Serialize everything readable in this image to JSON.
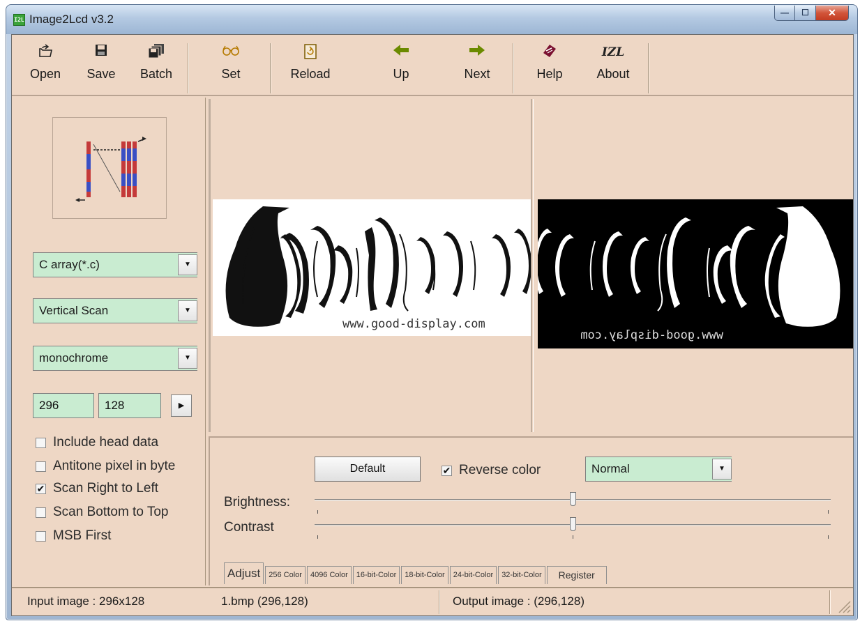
{
  "window": {
    "title": "Image2Lcd v3.2",
    "icon_text": "I2L",
    "controls": {
      "minimize": "—",
      "maximize": "☐",
      "close": "✕"
    }
  },
  "toolbar": {
    "open": "Open",
    "save": "Save",
    "batch": "Batch",
    "set": "Set",
    "reload": "Reload",
    "up": "Up",
    "next": "Next",
    "help": "Help",
    "about": "About",
    "about_icon_text": "IZL"
  },
  "left_panel": {
    "output_type": "C array(*.c)",
    "scan_mode": "Vertical Scan",
    "color_depth": "monochrome",
    "width": "296",
    "height": "128",
    "options": [
      {
        "label": "Include head data",
        "checked": false
      },
      {
        "label": "Antitone pixel in byte",
        "checked": false
      },
      {
        "label": "Scan Right to Left",
        "checked": true
      },
      {
        "label": "Scan Bottom to Top",
        "checked": false
      },
      {
        "label": "MSB First",
        "checked": false
      }
    ]
  },
  "preview": {
    "input_caption": "www.good-display.com",
    "output_caption": "www.good-display.com"
  },
  "adjust": {
    "default_button": "Default",
    "reverse_color_label": "Reverse color",
    "reverse_color_checked": true,
    "mode": "Normal",
    "brightness_label": "Brightness:",
    "contrast_label": "Contrast",
    "brightness_level": 0.5,
    "contrast_level": 0.5
  },
  "tabs": [
    "Adjust",
    "256 Color",
    "4096 Color",
    "16-bit-Color",
    "18-bit-Color",
    "24-bit-Color",
    "32-bit-Color",
    "Register"
  ],
  "status": {
    "input": "Input image : 296x128",
    "file": "1.bmp  (296,128)",
    "output": "Output image :  (296,128)"
  },
  "colors": {
    "panel": "#eed7c5",
    "field": "#c9ecd1",
    "titlebar": "#b4c9e2",
    "close_button": "#c33c22"
  }
}
